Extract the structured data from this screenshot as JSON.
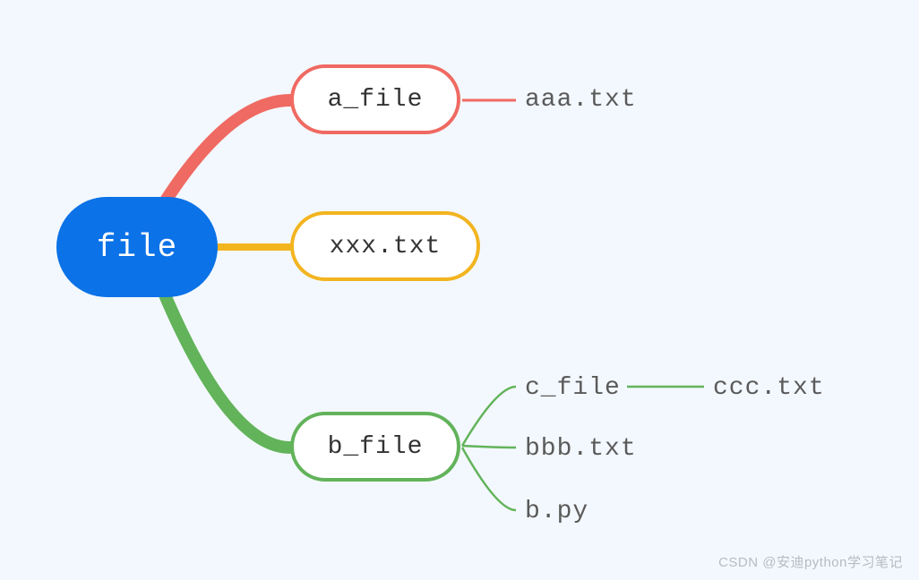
{
  "root": {
    "label": "file"
  },
  "children": {
    "a_file": {
      "label": "a_file",
      "children": {
        "aaa": "aaa.txt"
      }
    },
    "xxx": {
      "label": "xxx.txt"
    },
    "b_file": {
      "label": "b_file",
      "children": {
        "c_file": {
          "label": "c_file",
          "children": {
            "ccc": "ccc.txt"
          }
        },
        "bbb": "bbb.txt",
        "bpy": "b.py"
      }
    }
  },
  "colors": {
    "root": "#0b72e7",
    "a_file": "#ef6a62",
    "xxx": "#f2b41f",
    "b_file": "#62b35a"
  },
  "watermark": "CSDN @安迪python学习笔记"
}
